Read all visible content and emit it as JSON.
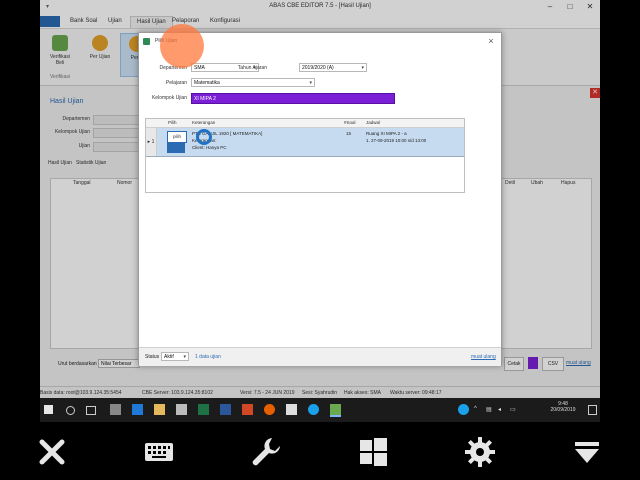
{
  "app": {
    "title": "ABAS CBE EDITOR 7.5 - [Hasil Ujian]",
    "ribbon_tabs": [
      "Bank Soal",
      "Ujian",
      "Hasil Ujian",
      "Pelaporan",
      "Konfigurasi"
    ],
    "active_tab_index": 2,
    "ribbon_buttons": [
      {
        "label": "Verifikasi\nBeli",
        "icon": "verify-icon"
      },
      {
        "label": "Per Ujian",
        "icon": "medal-icon"
      },
      {
        "label": "Per R",
        "icon": "medal-icon"
      }
    ],
    "ribbon_group_label": "Verifikasi",
    "left_panel": {
      "title": "Hasil Ujian",
      "fields": [
        "Departemen",
        "Kelompok Ujian",
        "Ujian"
      ],
      "tabs": [
        "Hasil Ujian",
        "Statistik Ujian"
      ]
    },
    "grid_headers": [
      "Tanggal",
      "Nomor",
      "Detil",
      "Ubah",
      "Hapus"
    ],
    "bottom": {
      "sort_label": "Urut berdasarkan",
      "sort_value": "Nilai Terbesar",
      "btn_cetak": "Cetak",
      "btn_csv": "CSV",
      "link_muat_ulang": "muat ulang"
    },
    "status": {
      "db": "Basis data: root@103.9.124.35:5454",
      "cbe_server": "CBE Server: 103.9.124.35:8102",
      "version": "Versi: 7.5 - 24 JUN 2019",
      "user": "Sesi: Syahrudin",
      "access": "Hak akses: SMA",
      "server_time": "Waktu server: 09:48:17"
    }
  },
  "dialog": {
    "title": "Pilih Ujian",
    "fields": {
      "departemen_label": "Departemen",
      "departemen_value": "SMA",
      "tahun_label": "Tahun Ajaran",
      "tahun_value": "2019/2020 (A)",
      "pelajaran_label": "Pelajaran",
      "pelajaran_value": "Matematika",
      "kelompok_label": "Kelompok Ujian",
      "kelompok_value": "XI MIPA 2"
    },
    "grid": {
      "headers": [
        "Pilih",
        "Keterangan",
        "#Soal",
        "Jadwal"
      ],
      "rows": [
        {
          "no": "1",
          "pilih": "pilih",
          "keterangan_line1": "PTS GANJIL 1920 [ MATEMATIKA]",
          "keterangan_line2": "Keterangan:",
          "keterangan_line3": "Client: Hanya PC",
          "soal": "15",
          "jadwal_line1": "Ruang XI MIPA 2 - a",
          "jadwal_line2": "1. 27-09-2019 10:00 s/d 13:00"
        }
      ]
    },
    "bottom": {
      "status_label": "Status",
      "status_value": "Aktif",
      "count": "1 data ujian",
      "refresh": "muat ulang"
    }
  },
  "taskbar": {
    "time": "9:48",
    "date": "20/09/2019"
  },
  "remote_toolbar": [
    "close-icon",
    "keyboard-icon",
    "wrench-icon",
    "windows-icon",
    "gear-icon",
    "dropdown-icon"
  ]
}
